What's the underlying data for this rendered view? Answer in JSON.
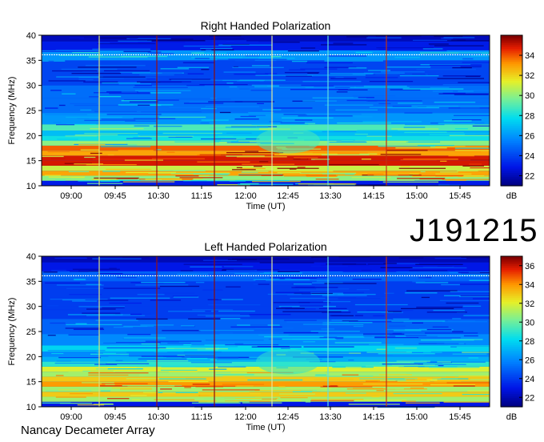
{
  "observation_id": "J191215",
  "instrument": "Nancay Decameter Array",
  "chart_data": [
    {
      "type": "heatmap",
      "title": "Right Handed Polarization",
      "xlabel": "Time (UT)",
      "ylabel": "Frequency (MHz)",
      "x_ticks": [
        "09:00",
        "09:45",
        "10:30",
        "11:15",
        "12:00",
        "12:45",
        "13:30",
        "14:15",
        "15:00",
        "15:45"
      ],
      "y_ticks": [
        10,
        15,
        20,
        25,
        30,
        35,
        40
      ],
      "ylim": [
        10,
        40
      ],
      "colorbar": {
        "unit": "dB",
        "ticks": [
          22,
          24,
          26,
          28,
          30,
          32,
          34
        ],
        "range": [
          21,
          36
        ]
      },
      "intensity_profile": [
        {
          "freq": 10.5,
          "db": 23
        },
        {
          "freq": 11.5,
          "db": 30
        },
        {
          "freq": 12.5,
          "db": 33
        },
        {
          "freq": 13.5,
          "db": 31
        },
        {
          "freq": 14.5,
          "db": 35
        },
        {
          "freq": 15.5,
          "db": 35
        },
        {
          "freq": 16.5,
          "db": 33
        },
        {
          "freq": 17.5,
          "db": 34
        },
        {
          "freq": 18.5,
          "db": 30
        },
        {
          "freq": 19.5,
          "db": 28
        },
        {
          "freq": 20.5,
          "db": 27
        },
        {
          "freq": 21.5,
          "db": 29
        },
        {
          "freq": 23,
          "db": 26
        },
        {
          "freq": 26,
          "db": 25
        },
        {
          "freq": 29,
          "db": 25
        },
        {
          "freq": 31,
          "db": 24
        },
        {
          "freq": 34,
          "db": 24
        },
        {
          "freq": 36,
          "db": 26
        },
        {
          "freq": 38,
          "db": 23
        },
        {
          "freq": 39.5,
          "db": 22
        }
      ]
    },
    {
      "type": "heatmap",
      "title": "Left Handed Polarization",
      "xlabel": "Time (UT)",
      "ylabel": "Frequency (MHz)",
      "x_ticks": [
        "09:00",
        "09:45",
        "10:30",
        "11:15",
        "12:00",
        "12:45",
        "13:30",
        "14:15",
        "15:00",
        "15:45"
      ],
      "y_ticks": [
        10,
        15,
        20,
        25,
        30,
        35,
        40
      ],
      "ylim": [
        10,
        40
      ],
      "colorbar": {
        "unit": "dB",
        "ticks": [
          22,
          24,
          26,
          28,
          30,
          32,
          34,
          36
        ],
        "range": [
          21,
          37
        ]
      },
      "intensity_profile": [
        {
          "freq": 10.5,
          "db": 23
        },
        {
          "freq": 11.5,
          "db": 31
        },
        {
          "freq": 12.5,
          "db": 33
        },
        {
          "freq": 13.5,
          "db": 31
        },
        {
          "freq": 14.5,
          "db": 34
        },
        {
          "freq": 15.5,
          "db": 33
        },
        {
          "freq": 16.5,
          "db": 31
        },
        {
          "freq": 17.5,
          "db": 32
        },
        {
          "freq": 18.5,
          "db": 29
        },
        {
          "freq": 19.5,
          "db": 27
        },
        {
          "freq": 20.5,
          "db": 26
        },
        {
          "freq": 21.5,
          "db": 28
        },
        {
          "freq": 23,
          "db": 26
        },
        {
          "freq": 26,
          "db": 25
        },
        {
          "freq": 29,
          "db": 24
        },
        {
          "freq": 31,
          "db": 24
        },
        {
          "freq": 34,
          "db": 24
        },
        {
          "freq": 36,
          "db": 25
        },
        {
          "freq": 38,
          "db": 23
        },
        {
          "freq": 39.5,
          "db": 22
        }
      ]
    }
  ]
}
